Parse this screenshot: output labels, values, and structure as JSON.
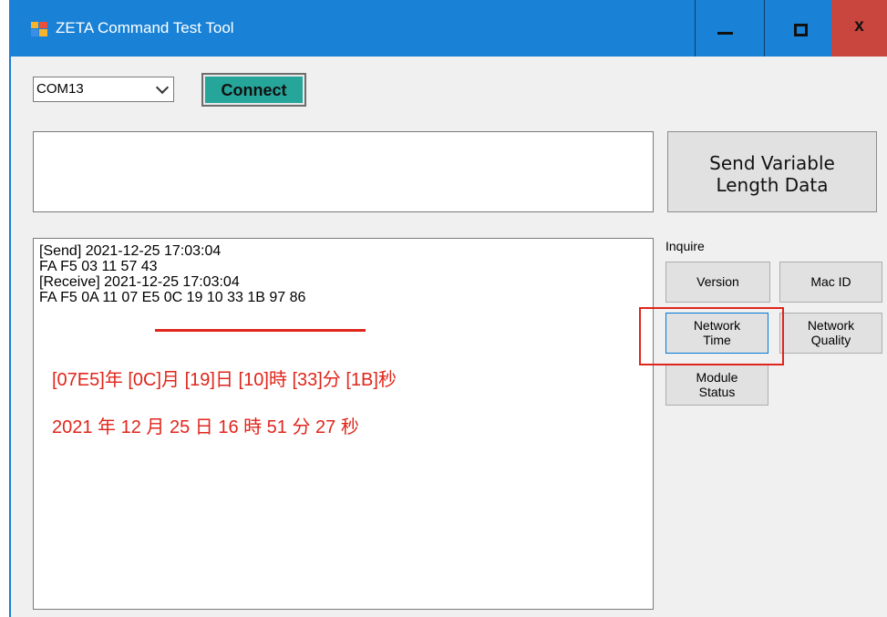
{
  "window": {
    "title": "ZETA Command Test Tool",
    "close_glyph": "x"
  },
  "port": {
    "selected": "COM13"
  },
  "connect": {
    "label": "Connect"
  },
  "send_variable": {
    "line1": "Send Variable",
    "line2": "Length Data"
  },
  "inquire": {
    "label": "Inquire",
    "buttons": {
      "version": "Version",
      "mac_id": "Mac ID",
      "network_time": [
        "Network",
        "Time"
      ],
      "network_quality": [
        "Network",
        "Quality"
      ],
      "module_status": [
        "Module",
        "Status"
      ]
    }
  },
  "log": {
    "lines": [
      "[Send] 2021-12-25 17:03:04",
      "FA F5 03 11 57 43",
      "[Receive] 2021-12-25 17:03:04",
      "FA F5 0A 11 07 E5 0C 19 10 33 1B 97 86"
    ],
    "annotation_hex": "[07E5]年 [0C]月 [19]日 [10]時 [33]分 [1B]秒",
    "annotation_dec": "2021 年 12 月 25 日 16 時 51 分 27 秒"
  },
  "colors": {
    "titlebar": "#1a82d6",
    "connect": "#26a69a",
    "annotation": "#e0251b",
    "close": "#c8463e"
  }
}
